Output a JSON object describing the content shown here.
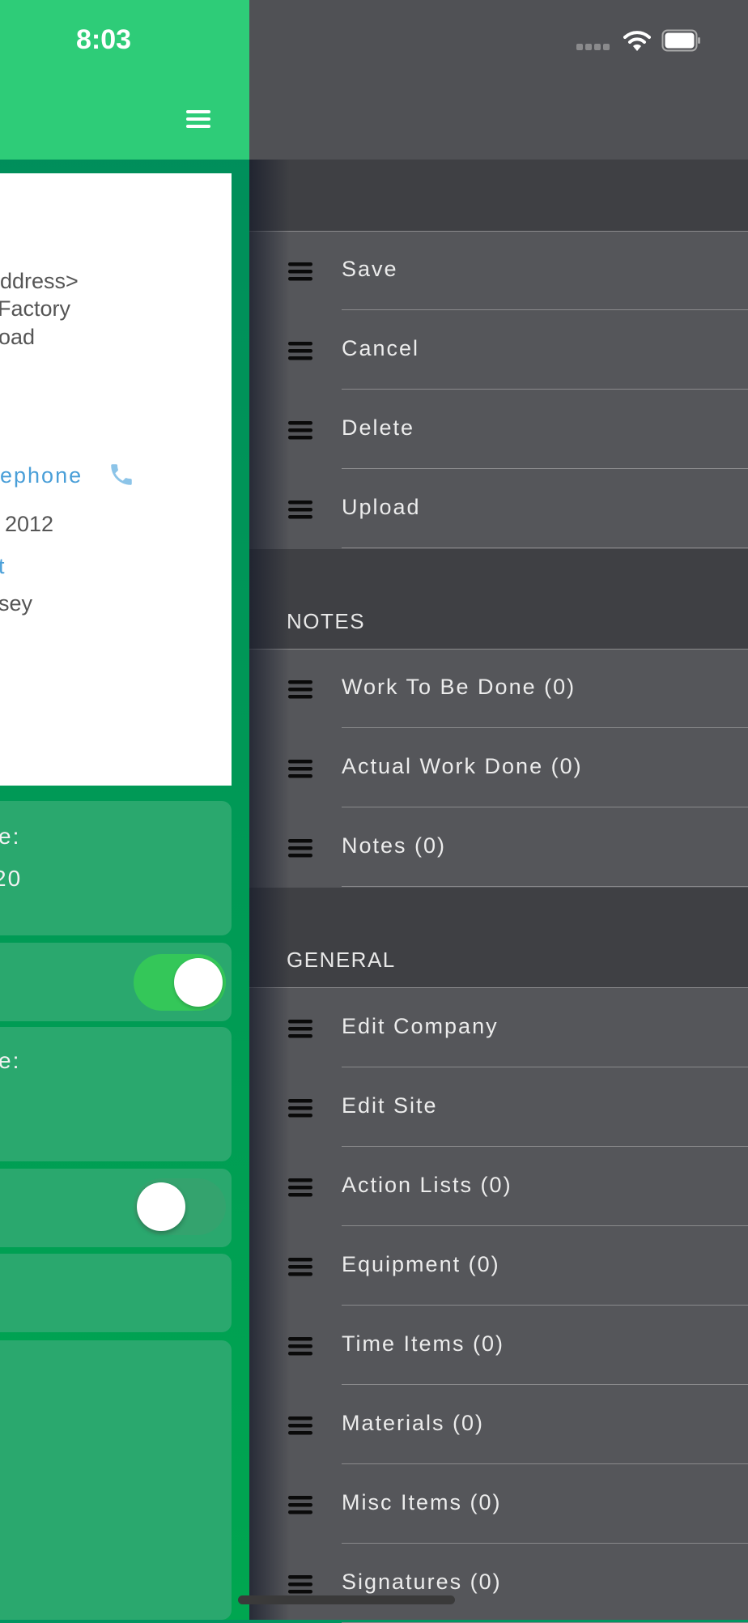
{
  "status_bar": {
    "time": "8:03",
    "icons": [
      "signal-icon",
      "wifi-icon",
      "battery-icon"
    ]
  },
  "header": {
    "menu_icon": "hamburger-icon"
  },
  "card": {
    "address_label": "ddress>",
    "address_line1": "Factory",
    "address_line2": "oad",
    "telephone_label": "ephone",
    "date_fragment": "2012",
    "link_fragment": "t",
    "county_fragment": "sey"
  },
  "blocks": {
    "block1_label": "e:",
    "block1_value": "20",
    "toggle1_on": true,
    "block3_label": "e:",
    "toggle2_on": false
  },
  "drawer": {
    "actions": [
      {
        "label": "Save"
      },
      {
        "label": "Cancel"
      },
      {
        "label": "Delete"
      },
      {
        "label": "Upload"
      }
    ],
    "notes_header": "NOTES",
    "notes": [
      {
        "label": "Work To Be Done (0)"
      },
      {
        "label": "Actual Work Done (0)"
      },
      {
        "label": "Notes (0)"
      }
    ],
    "general_header": "GENERAL",
    "general": [
      {
        "label": "Edit Company"
      },
      {
        "label": "Edit Site"
      },
      {
        "label": "Action Lists (0)"
      },
      {
        "label": "Equipment (0)"
      },
      {
        "label": "Time Items (0)"
      },
      {
        "label": "Materials (0)"
      },
      {
        "label": "Misc Items (0)"
      },
      {
        "label": "Signatures (0)"
      }
    ]
  },
  "colors": {
    "header_green": "#2ecc78",
    "drawer_bg": "#55565a",
    "section_bg": "#3f4044",
    "link_blue": "#4a9fd8",
    "toggle_on": "#34c759"
  }
}
